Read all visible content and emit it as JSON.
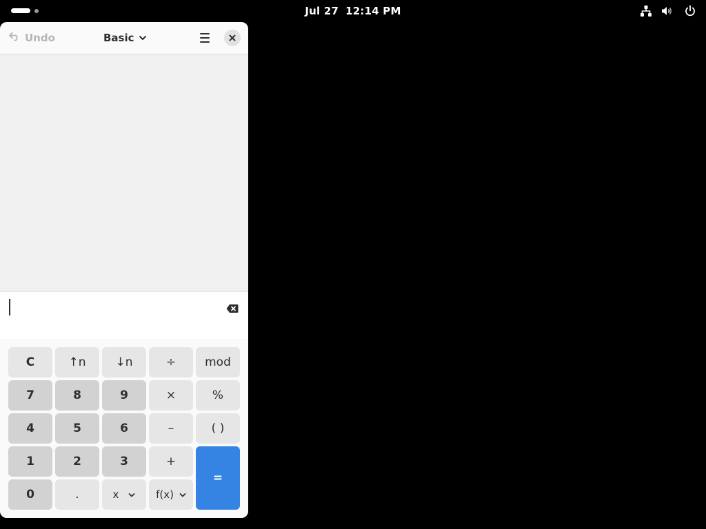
{
  "topbar": {
    "date": "Jul 27",
    "time": "12:14 PM",
    "icons": [
      "network-icon",
      "volume-icon",
      "power-icon"
    ]
  },
  "calculator": {
    "header": {
      "undo_label": "Undo",
      "mode_label": "Basic",
      "icons": [
        "undo-icon",
        "chevron-down-icon",
        "hamburger-menu-icon",
        "close-icon"
      ]
    },
    "entry": {
      "value": ""
    },
    "keys": {
      "clear": "C",
      "shift_left": "↑n",
      "shift_right": "↓n",
      "divide": "÷",
      "mod": "mod",
      "seven": "7",
      "eight": "8",
      "nine": "9",
      "multiply": "×",
      "percent": "%",
      "four": "4",
      "five": "5",
      "six": "6",
      "subtract": "–",
      "parens": "( )",
      "one": "1",
      "two": "2",
      "three": "3",
      "add": "+",
      "equals": "=",
      "zero": "0",
      "decimal": ".",
      "variable": "x",
      "function": "f(x)"
    },
    "colors": {
      "accent": "#3584e4",
      "number_key": "#d2d2d2",
      "operator_key": "#e6e6e6"
    }
  }
}
